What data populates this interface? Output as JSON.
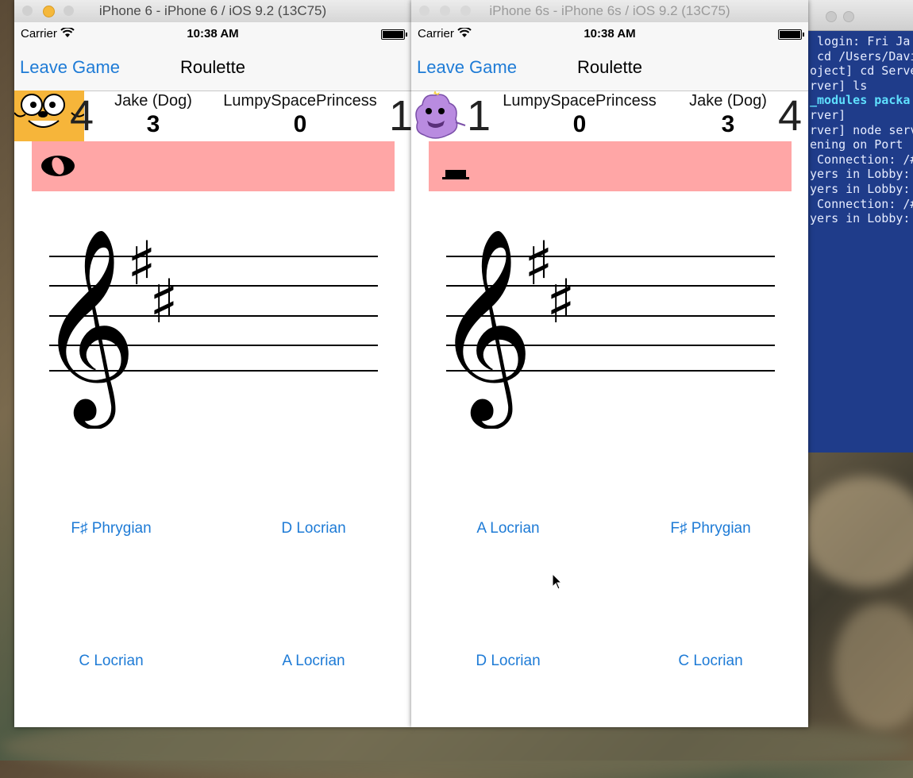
{
  "terminal": {
    "lines": [
      " login: Fri Ja",
      " cd /Users/Davi",
      "",
      "oject] cd Serve",
      "",
      "rver] ls",
      "_modules packa",
      "rver]",
      "rver] node serv",
      "ening on Port",
      " Connection: /#",
      "yers in Lobby:",
      "yers in Lobby:",
      " Connection: /#",
      "yers in Lobby:"
    ]
  },
  "sims": [
    {
      "window_title": "iPhone 6 - iPhone 6 / iOS 9.2 (13C75)",
      "status": {
        "carrier": "Carrier",
        "time": "10:38 AM"
      },
      "nav": {
        "back": "Leave Game",
        "title": "Roulette"
      },
      "me": {
        "name": "Jake (Dog)",
        "score": "3",
        "lives": "4",
        "avatar": "jake-avatar"
      },
      "opponent": {
        "name": "LumpySpacePrincess",
        "score": "0",
        "lives": "1"
      },
      "note_symbol": "whole-note",
      "key_signature": [
        "F#",
        "C#"
      ],
      "answers": [
        "F♯ Phrygian",
        "D Locrian",
        "C Locrian",
        "A Locrian"
      ]
    },
    {
      "window_title": "iPhone 6s - iPhone 6s / iOS 9.2 (13C75)",
      "status": {
        "carrier": "Carrier",
        "time": "10:38 AM"
      },
      "nav": {
        "back": "Leave Game",
        "title": "Roulette"
      },
      "me": {
        "name": "LumpySpacePrincess",
        "score": "0",
        "lives": "1",
        "avatar": "lsp-avatar"
      },
      "opponent": {
        "name": "Jake (Dog)",
        "score": "3",
        "lives": "4"
      },
      "note_symbol": "half-rest",
      "key_signature": [
        "F#",
        "C#"
      ],
      "answers": [
        "A Locrian",
        "F♯ Phrygian",
        "D Locrian",
        "C Locrian"
      ]
    }
  ],
  "colors": {
    "accent": "#1e7bd6",
    "note_box": "#ffa6a6",
    "terminal_bg": "#1f3c8a",
    "jake": "#f6b53a",
    "lsp": "#b98be0"
  }
}
